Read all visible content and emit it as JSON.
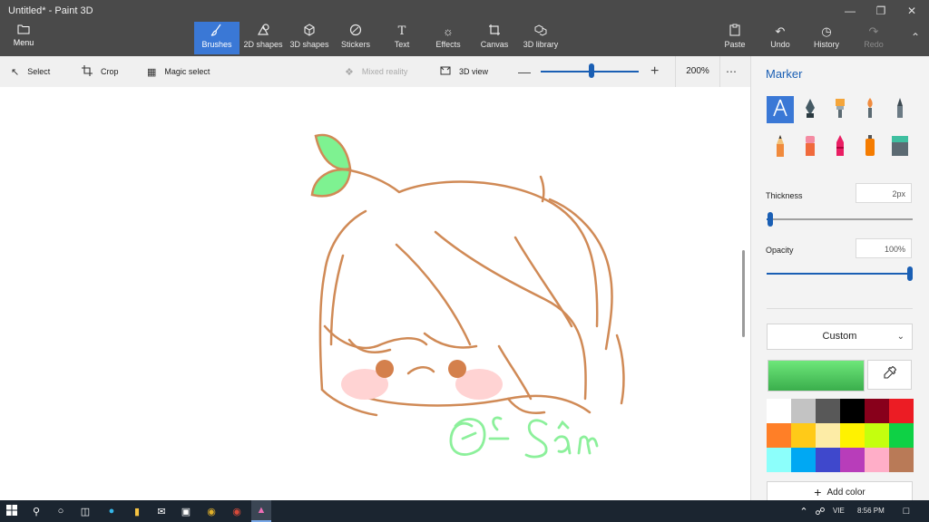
{
  "window": {
    "title": "Untitled* - Paint 3D"
  },
  "ribbon": {
    "menu_label": "Menu",
    "tabs": [
      {
        "label": "Brushes",
        "icon": "brush-icon"
      },
      {
        "label": "2D shapes",
        "icon": "2d-shapes-icon"
      },
      {
        "label": "3D shapes",
        "icon": "3d-shapes-icon"
      },
      {
        "label": "Stickers",
        "icon": "stickers-icon"
      },
      {
        "label": "Text",
        "icon": "text-icon"
      },
      {
        "label": "Effects",
        "icon": "effects-icon"
      },
      {
        "label": "Canvas",
        "icon": "canvas-icon"
      },
      {
        "label": "3D library",
        "icon": "3d-library-icon"
      }
    ],
    "actions": [
      {
        "label": "Paste",
        "icon": "paste-icon"
      },
      {
        "label": "Undo",
        "icon": "undo-icon"
      },
      {
        "label": "History",
        "icon": "history-icon"
      },
      {
        "label": "Redo",
        "icon": "redo-icon"
      }
    ]
  },
  "toolbar": {
    "select_label": "Select",
    "crop_label": "Crop",
    "magic_select_label": "Magic select",
    "mixed_reality_label": "Mixed reality",
    "view3d_label": "3D view",
    "zoom_value": "200%"
  },
  "panel": {
    "title": "Marker",
    "brushes": [
      "marker-icon",
      "calligraphy-pen-icon",
      "oil-brush-icon",
      "watercolor-icon",
      "pixel-pen-icon",
      "pencil-icon",
      "eraser-icon",
      "crayon-icon",
      "spray-can-icon",
      "fill-icon"
    ],
    "thickness_label": "Thickness",
    "thickness_value": "2px",
    "opacity_label": "Opacity",
    "opacity_value": "100%",
    "color_mode": "Custom",
    "selected_color": "#4cd964",
    "palette": [
      "#ffffff",
      "#c3c3c3",
      "#585858",
      "#000000",
      "#88001b",
      "#ec1c24",
      "#ff7f27",
      "#ffca18",
      "#fdeca6",
      "#fff200",
      "#c4ff0e",
      "#0ed145",
      "#8cfffb",
      "#00a8f3",
      "#3f48cc",
      "#b83dba",
      "#ffaec8",
      "#b97a57"
    ],
    "add_color_label": "Add color"
  },
  "taskbar": {
    "lang": "VIE",
    "time": "8:56 PM"
  }
}
